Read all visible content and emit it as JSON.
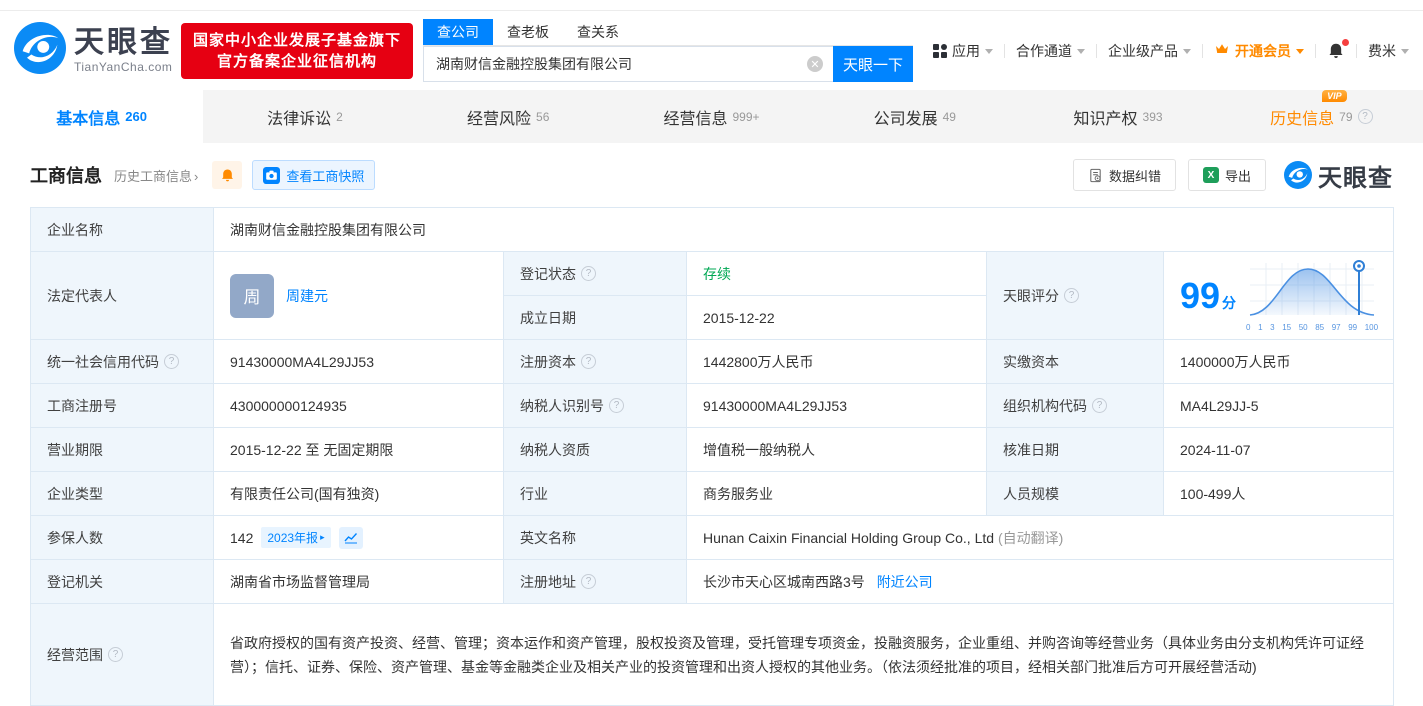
{
  "colors": {
    "primary": "#0084ff",
    "status_green": "#00a854",
    "vip_orange": "#ff8a00",
    "badge_red": "#e60012"
  },
  "brand": {
    "name": "天眼查",
    "domain": "TianYanCha.com",
    "cert_line1": "国家中小企业发展子基金旗下",
    "cert_line2": "官方备案企业征信机构"
  },
  "search": {
    "tabs": [
      "查公司",
      "查老板",
      "查关系"
    ],
    "value": "湖南财信金融控股集团有限公司",
    "submit": "天眼一下"
  },
  "topnav": {
    "apps": "应用",
    "cooperation": "合作通道",
    "enterprise": "企业级产品",
    "vip": "开通会员",
    "user": "费米"
  },
  "nav_tabs": [
    {
      "label": "基本信息",
      "count": "260"
    },
    {
      "label": "法律诉讼",
      "count": "2"
    },
    {
      "label": "经营风险",
      "count": "56"
    },
    {
      "label": "经营信息",
      "count": "999+"
    },
    {
      "label": "公司发展",
      "count": "49"
    },
    {
      "label": "知识产权",
      "count": "393"
    },
    {
      "label": "历史信息",
      "count": "79",
      "badge": "VIP"
    }
  ],
  "section": {
    "title": "工商信息",
    "history_link": "历史工商信息",
    "snapshot_button": "查看工商快照",
    "correction_button": "数据纠错",
    "export_button": "导出",
    "watermark": "天眼查"
  },
  "fields": {
    "company_name": {
      "label": "企业名称",
      "value": "湖南财信金融控股集团有限公司"
    },
    "legal_rep": {
      "label": "法定代表人",
      "value": "周建元",
      "avatar": "周"
    },
    "reg_status": {
      "label": "登记状态",
      "value": "存续"
    },
    "establish_date": {
      "label": "成立日期",
      "value": "2015-12-22"
    },
    "score": {
      "label": "天眼评分",
      "value": "99",
      "unit": "分"
    },
    "credit_code": {
      "label": "统一社会信用代码",
      "value": "91430000MA4L29JJ53"
    },
    "reg_capital": {
      "label": "注册资本",
      "value": "1442800万人民币"
    },
    "paid_capital": {
      "label": "实缴资本",
      "value": "1400000万人民币"
    },
    "reg_number": {
      "label": "工商注册号",
      "value": "430000000124935"
    },
    "taxpayer_id": {
      "label": "纳税人识别号",
      "value": "91430000MA4L29JJ53"
    },
    "org_code": {
      "label": "组织机构代码",
      "value": "MA4L29JJ-5"
    },
    "business_term": {
      "label": "营业期限",
      "value": "2015-12-22 至 无固定期限"
    },
    "taxpayer_quality": {
      "label": "纳税人资质",
      "value": "增值税一般纳税人"
    },
    "approval_date": {
      "label": "核准日期",
      "value": "2024-11-07"
    },
    "company_type": {
      "label": "企业类型",
      "value": "有限责任公司(国有独资)"
    },
    "industry": {
      "label": "行业",
      "value": "商务服务业"
    },
    "staff_size": {
      "label": "人员规模",
      "value": "100-499人"
    },
    "insured_count": {
      "label": "参保人数",
      "value": "142",
      "report_chip": "2023年报"
    },
    "english_name": {
      "label": "英文名称",
      "value": "Hunan Caixin Financial Holding Group Co., Ltd",
      "note": "(自动翻译)"
    },
    "reg_authority": {
      "label": "登记机关",
      "value": "湖南省市场监督管理局"
    },
    "reg_address": {
      "label": "注册地址",
      "value": "长沙市天心区城南西路3号",
      "nearby_link": "附近公司"
    },
    "business_scope": {
      "label": "经营范围",
      "value": "省政府授权的国有资产投资、经营、管理；资本运作和资产管理，股权投资及管理，受托管理专项资金，投融资服务，企业重组、并购咨询等经营业务（具体业务由分支机构凭许可证经营）；信托、证券、保险、资产管理、基金等金融类企业及相关产业的投资管理和出资人授权的其他业务。（依法须经批准的项目，经相关部门批准后方可开展经营活动)"
    }
  },
  "score_chart": {
    "type": "area",
    "x_ticks": [
      "0",
      "1",
      "3",
      "15",
      "50",
      "85",
      "97",
      "99",
      "100"
    ],
    "marker_value": "99"
  }
}
